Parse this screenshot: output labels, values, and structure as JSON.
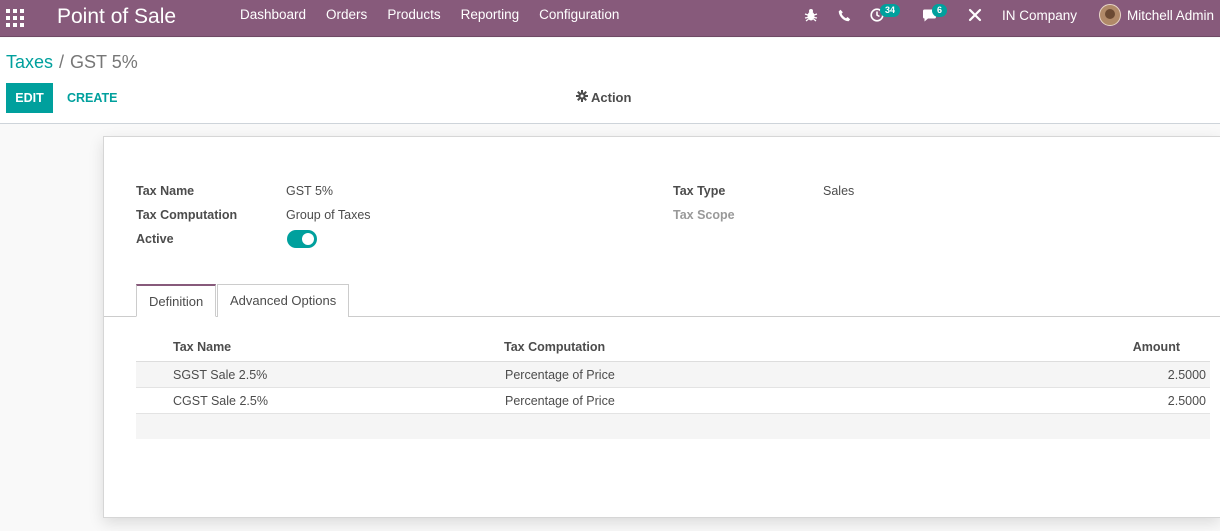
{
  "navbar": {
    "app_title": "Point of Sale",
    "menu": [
      "Dashboard",
      "Orders",
      "Products",
      "Reporting",
      "Configuration"
    ],
    "activity_count": "34",
    "message_count": "6",
    "company": "IN Company",
    "user_name": "Mitchell Admin",
    "icons": [
      "apps-grid-icon",
      "bug-icon",
      "phone-icon",
      "clock-icon",
      "chat-icon",
      "tools-icon"
    ]
  },
  "breadcrumb": {
    "parent": "Taxes",
    "separator": "/",
    "current": "GST 5%"
  },
  "buttons": {
    "edit": "EDIT",
    "create": "CREATE",
    "action": "Action"
  },
  "form": {
    "tax_name_label": "Tax Name",
    "tax_name_value": "GST 5%",
    "tax_computation_label": "Tax Computation",
    "tax_computation_value": "Group of Taxes",
    "active_label": "Active",
    "active_value": true,
    "tax_type_label": "Tax Type",
    "tax_type_value": "Sales",
    "tax_scope_label": "Tax Scope"
  },
  "tabs": [
    "Definition",
    "Advanced Options"
  ],
  "table": {
    "columns": [
      "Tax Name",
      "Tax Computation",
      "Amount"
    ],
    "rows": [
      {
        "tax_name": "SGST Sale 2.5%",
        "computation": "Percentage of Price",
        "amount": "2.5000"
      },
      {
        "tax_name": "CGST Sale 2.5%",
        "computation": "Percentage of Price",
        "amount": "2.5000"
      }
    ]
  },
  "colors": {
    "navbar": "#875a7b",
    "primary": "#00a09d"
  }
}
